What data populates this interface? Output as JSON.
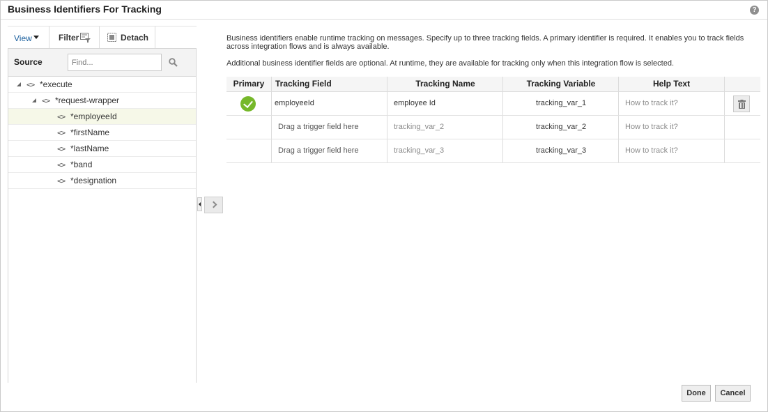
{
  "dialog": {
    "title": "Business Identifiers For Tracking",
    "help_glyph": "?"
  },
  "toolbar": {
    "view_label": "View",
    "filter_label": "Filter",
    "detach_label": "Detach"
  },
  "source_panel": {
    "header": "Source",
    "find_placeholder": "Find...",
    "tree": [
      {
        "label": "*execute",
        "icon": "<>",
        "expanded": true
      },
      {
        "label": "*request-wrapper",
        "icon": "<>",
        "expanded": true
      },
      {
        "label": "*employeeId",
        "icon": "<>",
        "selected": true
      },
      {
        "label": "*firstName",
        "icon": "<>"
      },
      {
        "label": "*lastName",
        "icon": "<>"
      },
      {
        "label": "*band",
        "icon": "<>"
      },
      {
        "label": "*designation",
        "icon": "<>"
      }
    ]
  },
  "description": {
    "line1": "Business identifiers enable runtime tracking on messages. Specify up to three tracking fields. A primary identifier is required. It enables you to track fields across integration flows and is always available.",
    "line2": "Additional business identifier fields are optional. At runtime, they are available for tracking only when this integration flow is selected."
  },
  "tracking_table": {
    "columns": [
      "Primary",
      "Tracking Field",
      "Tracking Name",
      "Tracking Variable",
      "Help Text"
    ],
    "rows": [
      {
        "primary": true,
        "field": "employeeId",
        "name": "employee Id",
        "variable": "tracking_var_1",
        "help": "How to track it?"
      },
      {
        "primary": false,
        "field": "Drag a trigger field here",
        "name": "tracking_var_2",
        "variable": "tracking_var_2",
        "help": "How to track it?"
      },
      {
        "primary": false,
        "field": "Drag a trigger field here",
        "name": "tracking_var_3",
        "variable": "tracking_var_3",
        "help": "How to track it?"
      }
    ]
  },
  "footer": {
    "done_label": "Done",
    "cancel_label": "Cancel"
  },
  "colors": {
    "accent_link": "#1a5f9e",
    "primary_check": "#76b82a",
    "selected_row": "#f6f8e8"
  }
}
